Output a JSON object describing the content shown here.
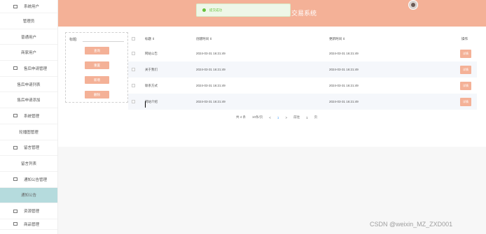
{
  "header": {
    "title": "交易系统",
    "toast": "提交成功"
  },
  "sidebar": {
    "items": [
      {
        "label": "系统用户",
        "type": "group"
      },
      {
        "label": "管理员",
        "type": "item"
      },
      {
        "label": "普通用户",
        "type": "item"
      },
      {
        "label": "商家用户",
        "type": "item"
      },
      {
        "label": "售后申请管理",
        "type": "group"
      },
      {
        "label": "售后申请列表",
        "type": "item"
      },
      {
        "label": "售后申请添加",
        "type": "item"
      },
      {
        "label": "系统管理",
        "type": "group"
      },
      {
        "label": "轮播图管理",
        "type": "item"
      },
      {
        "label": "留言管理",
        "type": "group"
      },
      {
        "label": "留言列表",
        "type": "item"
      },
      {
        "label": "通知公告管理",
        "type": "group"
      },
      {
        "label": "通知公告",
        "type": "item",
        "active": true
      },
      {
        "label": "资源管理",
        "type": "group"
      },
      {
        "label": "商品管理",
        "type": "group"
      }
    ]
  },
  "search": {
    "label": "标题:",
    "placeholder": "",
    "buttons": [
      "查询",
      "重置",
      "新增",
      "删除"
    ]
  },
  "table": {
    "headers": {
      "title": "标题 ⇕",
      "created": "创建时间 ⇕",
      "updated": "更新时间 ⇕",
      "op": "操作"
    },
    "rows": [
      {
        "title": "网站公告",
        "created": "2024-03-31 16:21:49",
        "updated": "2024-03-31 16:21:49",
        "op": "详情"
      },
      {
        "title": "关于我们",
        "created": "2024-03-31 16:21:49",
        "updated": "2024-03-31 16:21:49",
        "op": "详情"
      },
      {
        "title": "联系方式",
        "created": "2024-03-31 16:21:49",
        "updated": "2024-03-31 16:21:49",
        "op": "详情"
      },
      {
        "title": "网站介绍",
        "created": "2024-03-31 16:21:49",
        "updated": "2024-03-31 16:21:49",
        "op": "详情"
      }
    ]
  },
  "pager": {
    "total": "共 4 条",
    "size": "10条/页",
    "prev": "<",
    "page": "1",
    "next": ">",
    "goto": "前往",
    "goto_value": "1",
    "goto_unit": "页"
  },
  "watermark": "CSDN @weixin_MZ_ZXD001",
  "colors": {
    "accent": "#f4b197",
    "active_sidebar": "#b5dbdd",
    "toast_green": "#67c23a",
    "row_alt": "#f5f7fb"
  }
}
